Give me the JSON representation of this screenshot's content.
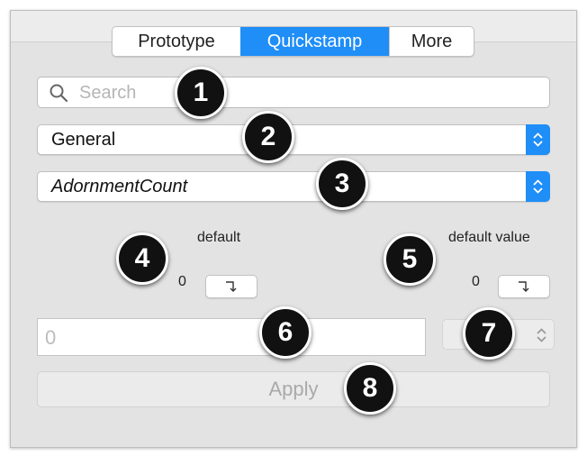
{
  "tabs": [
    "Prototype",
    "Quickstamp",
    "More"
  ],
  "active_tab": "Quickstamp",
  "search": {
    "placeholder": "Search",
    "value": ""
  },
  "category_popup": {
    "value": "General"
  },
  "attribute_popup": {
    "value": "AdornmentCount"
  },
  "default_section": {
    "label": "default",
    "value": "0"
  },
  "default_value_section": {
    "label": "default value",
    "value": "0"
  },
  "value_field": {
    "placeholder": "0",
    "value": ""
  },
  "apply_button": {
    "label": "Apply"
  },
  "callouts": [
    "1",
    "2",
    "3",
    "4",
    "5",
    "6",
    "7",
    "8"
  ],
  "colors": {
    "accent": "#1f8ef7",
    "panel": "#e3e3e3",
    "badge": "#111111"
  }
}
